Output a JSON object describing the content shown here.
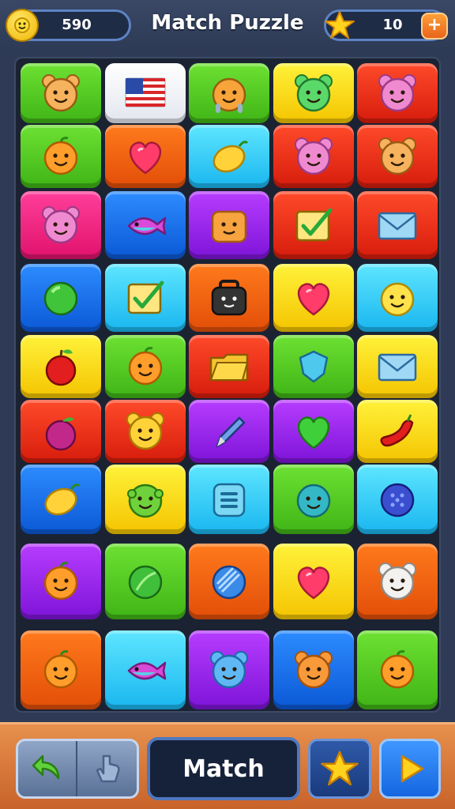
{
  "header": {
    "title": "Match Puzzle",
    "coins": {
      "value": "590",
      "icon": "coin-icon"
    },
    "stars": {
      "value": "10",
      "icon": "star-icon",
      "add_icon": "plus-icon"
    }
  },
  "board": {
    "columns": 5,
    "rows": 9,
    "tiles": [
      {
        "color": "green",
        "icon": "bear-face-icon"
      },
      {
        "color": "white",
        "icon": "us-flag-icon"
      },
      {
        "color": "green",
        "icon": "orange-creature-icon"
      },
      {
        "color": "yellow",
        "icon": "green-bear-icon"
      },
      {
        "color": "red",
        "icon": "pink-bear-icon"
      },
      {
        "color": "green",
        "icon": "orange-face-icon"
      },
      {
        "color": "orange",
        "icon": "heart-icon"
      },
      {
        "color": "cyan",
        "icon": "lemon-icon"
      },
      {
        "color": "red",
        "icon": "pink-bear-icon"
      },
      {
        "color": "red",
        "icon": "bear-face-icon"
      },
      {
        "color": "pink",
        "icon": "pink-bear-icon"
      },
      {
        "color": "blue",
        "icon": "fish-icon"
      },
      {
        "color": "purple",
        "icon": "orange-box-face-icon"
      },
      {
        "color": "red",
        "icon": "checkbox-icon"
      },
      {
        "color": "red",
        "icon": "envelope-icon"
      },
      {
        "color": "blue",
        "icon": "green-ball-icon"
      },
      {
        "color": "cyan",
        "icon": "checkbox-icon"
      },
      {
        "color": "orange",
        "icon": "black-bag-face-icon"
      },
      {
        "color": "yellow",
        "icon": "heart-icon"
      },
      {
        "color": "cyan",
        "icon": "smiley-icon"
      },
      {
        "color": "yellow",
        "icon": "apple-icon"
      },
      {
        "color": "green",
        "icon": "orange-face-icon"
      },
      {
        "color": "red",
        "icon": "folder-icon"
      },
      {
        "color": "green",
        "icon": "shield-gem-icon"
      },
      {
        "color": "yellow",
        "icon": "envelope-icon"
      },
      {
        "color": "red",
        "icon": "plum-icon"
      },
      {
        "color": "red",
        "icon": "yellow-bear-icon"
      },
      {
        "color": "purple",
        "icon": "pen-icon"
      },
      {
        "color": "purple",
        "icon": "green-heart-icon"
      },
      {
        "color": "yellow",
        "icon": "chili-pepper-icon"
      },
      {
        "color": "blue",
        "icon": "lemon-icon"
      },
      {
        "color": "yellow",
        "icon": "green-blob-face-icon"
      },
      {
        "color": "cyan",
        "icon": "list-icon"
      },
      {
        "color": "green",
        "icon": "teal-ball-face-icon"
      },
      {
        "color": "cyan",
        "icon": "button-icon"
      },
      {
        "color": "purple",
        "icon": "orange-face-icon"
      },
      {
        "color": "green",
        "icon": "green-leaf-icon"
      },
      {
        "color": "orange",
        "icon": "blue-striped-ball-icon"
      },
      {
        "color": "yellow",
        "icon": "heart-icon"
      },
      {
        "color": "orange",
        "icon": "white-bear-icon"
      },
      {
        "color": "orange",
        "icon": "orange-face-icon"
      },
      {
        "color": "cyan",
        "icon": "fish-icon"
      },
      {
        "color": "purple",
        "icon": "blue-bear-icon"
      },
      {
        "color": "blue",
        "icon": "orange-bear-icon"
      },
      {
        "color": "green",
        "icon": "orange-face-icon"
      }
    ]
  },
  "toolbar": {
    "undo_icon": "undo-arrow-icon",
    "hint_icon": "hint-pointer-icon",
    "match_label": "Match",
    "star_icon": "star-icon",
    "play_icon": "play-icon"
  },
  "colors": {
    "green": "#4fc21f",
    "white": "#f4f6fa",
    "yellow": "#fbe01a",
    "red": "#ec2f1a",
    "orange": "#f36412",
    "cyan": "#33ccf6",
    "pink": "#f02a84",
    "blue": "#1c72ec",
    "purple": "#9a27ea",
    "background": "#2f3b56",
    "board": "#1b2333"
  }
}
